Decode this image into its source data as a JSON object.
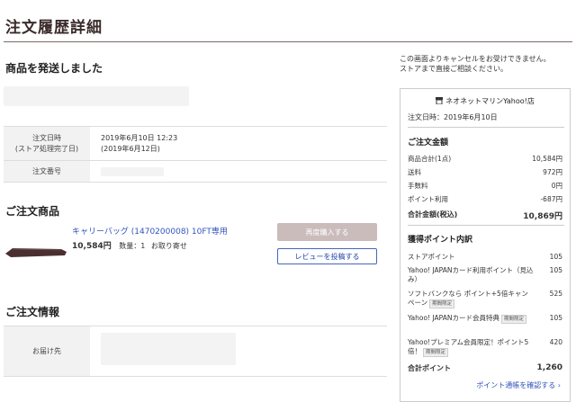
{
  "page": {
    "title": "注文履歴詳細"
  },
  "main": {
    "status_heading": "商品を発送しました",
    "info_rows": [
      {
        "label_line1": "注文日時",
        "label_line2": "(ストア処理完了日)",
        "value_line1": "2019年6月10日 12:23",
        "value_line2": "(2019年6月12日)"
      },
      {
        "label_line1": "注文番号",
        "label_line2": "",
        "value_line1": "",
        "value_line2": ""
      }
    ],
    "products_heading": "ご注文商品",
    "product": {
      "name": "キャリーバッグ (1470200008) 10FT専用",
      "price": "10,584円",
      "quantity": "数量：1",
      "stock": "お取り寄せ",
      "rebuy_label": "再度購入する",
      "review_label": "レビューを投稿する"
    },
    "order_info_heading": "ご注文情報",
    "ship_label": "お届け先"
  },
  "side": {
    "note_line1": "この画面よりキャンセルをお受けできません。",
    "note_line2": "ストアまで直接ご相談ください。",
    "store_name": "ネオネットマリンYahoo!店",
    "order_date": "注文日時：2019年6月10日",
    "amount_heading": "ご注文金額",
    "amounts": [
      {
        "label": "商品合計(1点)",
        "value": "10,584円"
      },
      {
        "label": "送料",
        "value": "972円"
      },
      {
        "label": "手数料",
        "value": "0円"
      },
      {
        "label": "ポイント利用",
        "value": "-687円"
      }
    ],
    "total_label": "合計金額(税込)",
    "total_value": "10,869円",
    "points_heading": "獲得ポイント内訳",
    "points": [
      {
        "label": "ストアポイント",
        "tag": "",
        "value": "105"
      },
      {
        "label": "Yahoo! JAPANカード利用ポイント（見込み）",
        "tag": "",
        "value": "105"
      },
      {
        "label": "ソフトバンクなら ポイント+5倍キャンペーン",
        "tag": "期間限定",
        "value": "525"
      },
      {
        "label": "Yahoo! JAPANカード会員特典",
        "tag": "期間限定",
        "value": "105"
      },
      {
        "label": "Yahoo!プレミアム会員限定！ポイント5倍！",
        "tag": "期間限定",
        "value": "420"
      }
    ],
    "points_total_label": "合計ポイント",
    "points_total_value": "1,260",
    "points_link": "ポイント通帳を確認する ›"
  }
}
